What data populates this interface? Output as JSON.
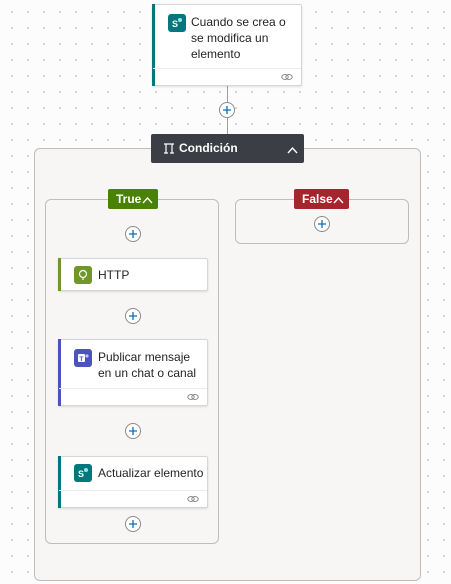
{
  "trigger": {
    "title": "Cuando se crea o se modifica un elemento",
    "icon": "sharepoint-icon",
    "accent": "#03787c"
  },
  "condition": {
    "title": "Condición",
    "icon": "condition-icon",
    "header_bg": "#3b3e45"
  },
  "branches": {
    "true": {
      "label": "True",
      "color": "#498205"
    },
    "false": {
      "label": "False",
      "color": "#a4262c"
    }
  },
  "actions": {
    "http": {
      "title": "HTTP",
      "icon": "http-globe-icon",
      "accent": "#709727"
    },
    "teams": {
      "title": "Publicar mensaje en un chat o canal",
      "icon": "teams-icon",
      "accent": "#4b53bc"
    },
    "update": {
      "title": "Actualizar elemento",
      "icon": "sharepoint-icon",
      "accent": "#03787c"
    }
  }
}
